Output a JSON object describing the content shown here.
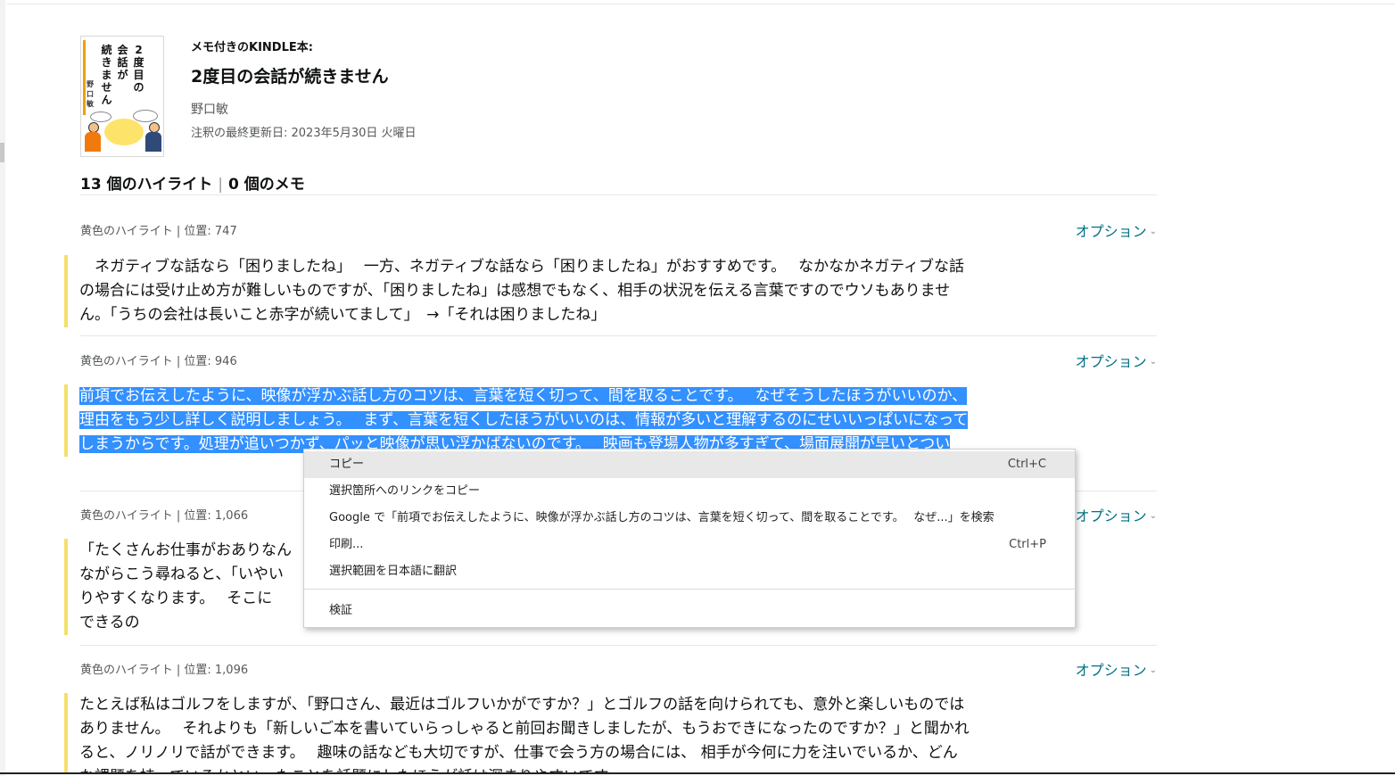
{
  "book": {
    "kicker": "メモ付きのKINDLE本:",
    "title": "2度目の会話が続きません",
    "author": "野口敏",
    "updated": "注釈の最終更新日:  2023年5月30日 火曜日",
    "cover": {
      "title_col1": "2度目の",
      "title_col2": "会話が",
      "title_col3": "続きません",
      "author": "野口敏"
    }
  },
  "counts": {
    "highlights": "13 個のハイライト",
    "separator": "|",
    "notes": "0 個のメモ"
  },
  "entries": [
    {
      "info": "黄色のハイライト | 位置: 747",
      "option": "オプション",
      "text": "　ネガティブな話なら「困りましたね」　 一方、ネガティブな話なら「困りましたね」がおすすめです。　 なかなかネガティブな話の場合には受け止め方が難しいものですが、「困りましたね」は感想でもなく、相手の状況を伝える言葉ですのでウソもありません。「うちの会社は長いこと赤字が続いてまして」　→「それは困りましたね」"
    },
    {
      "info": "黄色のハイライト | 位置: 946",
      "option": "オプション",
      "text": "前項でお伝えしたように、映像が浮かぶ話し方のコツは、言葉を短く切って、間を取ることです。　 なぜそうしたほうがいいのか、理由をもう少し詳しく説明しましょう。　 まず、言葉を短くしたほうがいいのは、情報が多いと理解するのにせいいっぱいになってしまうからです。処理が追いつかず、パッと映像が思い浮かばないのです。　 映画も登場人物が多すぎて、場面展開が早いとつい"
    },
    {
      "info": "黄色のハイライト | 位置: 1,066",
      "option": "オプション",
      "text": "「たくさんお仕事がおありなん",
      "text2": "ながらこう尋ねると、「いやい",
      "text3": "りやすくなります。　 そこに",
      "text4": "できるの"
    },
    {
      "info": "黄色のハイライト | 位置: 1,096",
      "option": "オプション",
      "text": "たとえば私はゴルフをしますが、「野口さん、最近はゴルフいかがですか？」とゴルフの話を向けられても、意外と楽しいものではありません。　 それよりも「新しいご本を書いていらっしゃると前回お聞きしましたが、もうおできになったのですか？」と聞かれると、ノリノリで話ができます。　 趣味の話なども大切ですが、仕事で会う方の場合には、 相手が今何に力を注いでいるか、どんな課題を持っているかといったことを話題にしたほうが話は深まりやすいです。"
    }
  ],
  "context_menu": {
    "items": [
      {
        "label": "コピー",
        "shortcut": "Ctrl+C"
      },
      {
        "label": "選択箇所へのリンクをコピー",
        "shortcut": ""
      },
      {
        "label": "Google で「前項でお伝えしたように、映像が浮かぶ話し方のコツは、言葉を短く切って、間を取ることです。　 なぜ...」を検索",
        "shortcut": ""
      },
      {
        "label": "印刷...",
        "shortcut": "Ctrl+P"
      },
      {
        "label": "選択範囲を日本語に翻訳",
        "shortcut": ""
      },
      {
        "label": "検証",
        "shortcut": ""
      }
    ]
  },
  "colors": {
    "highlight_bar": "#f4e06a",
    "selection": "#3390ff",
    "link": "#007185"
  }
}
